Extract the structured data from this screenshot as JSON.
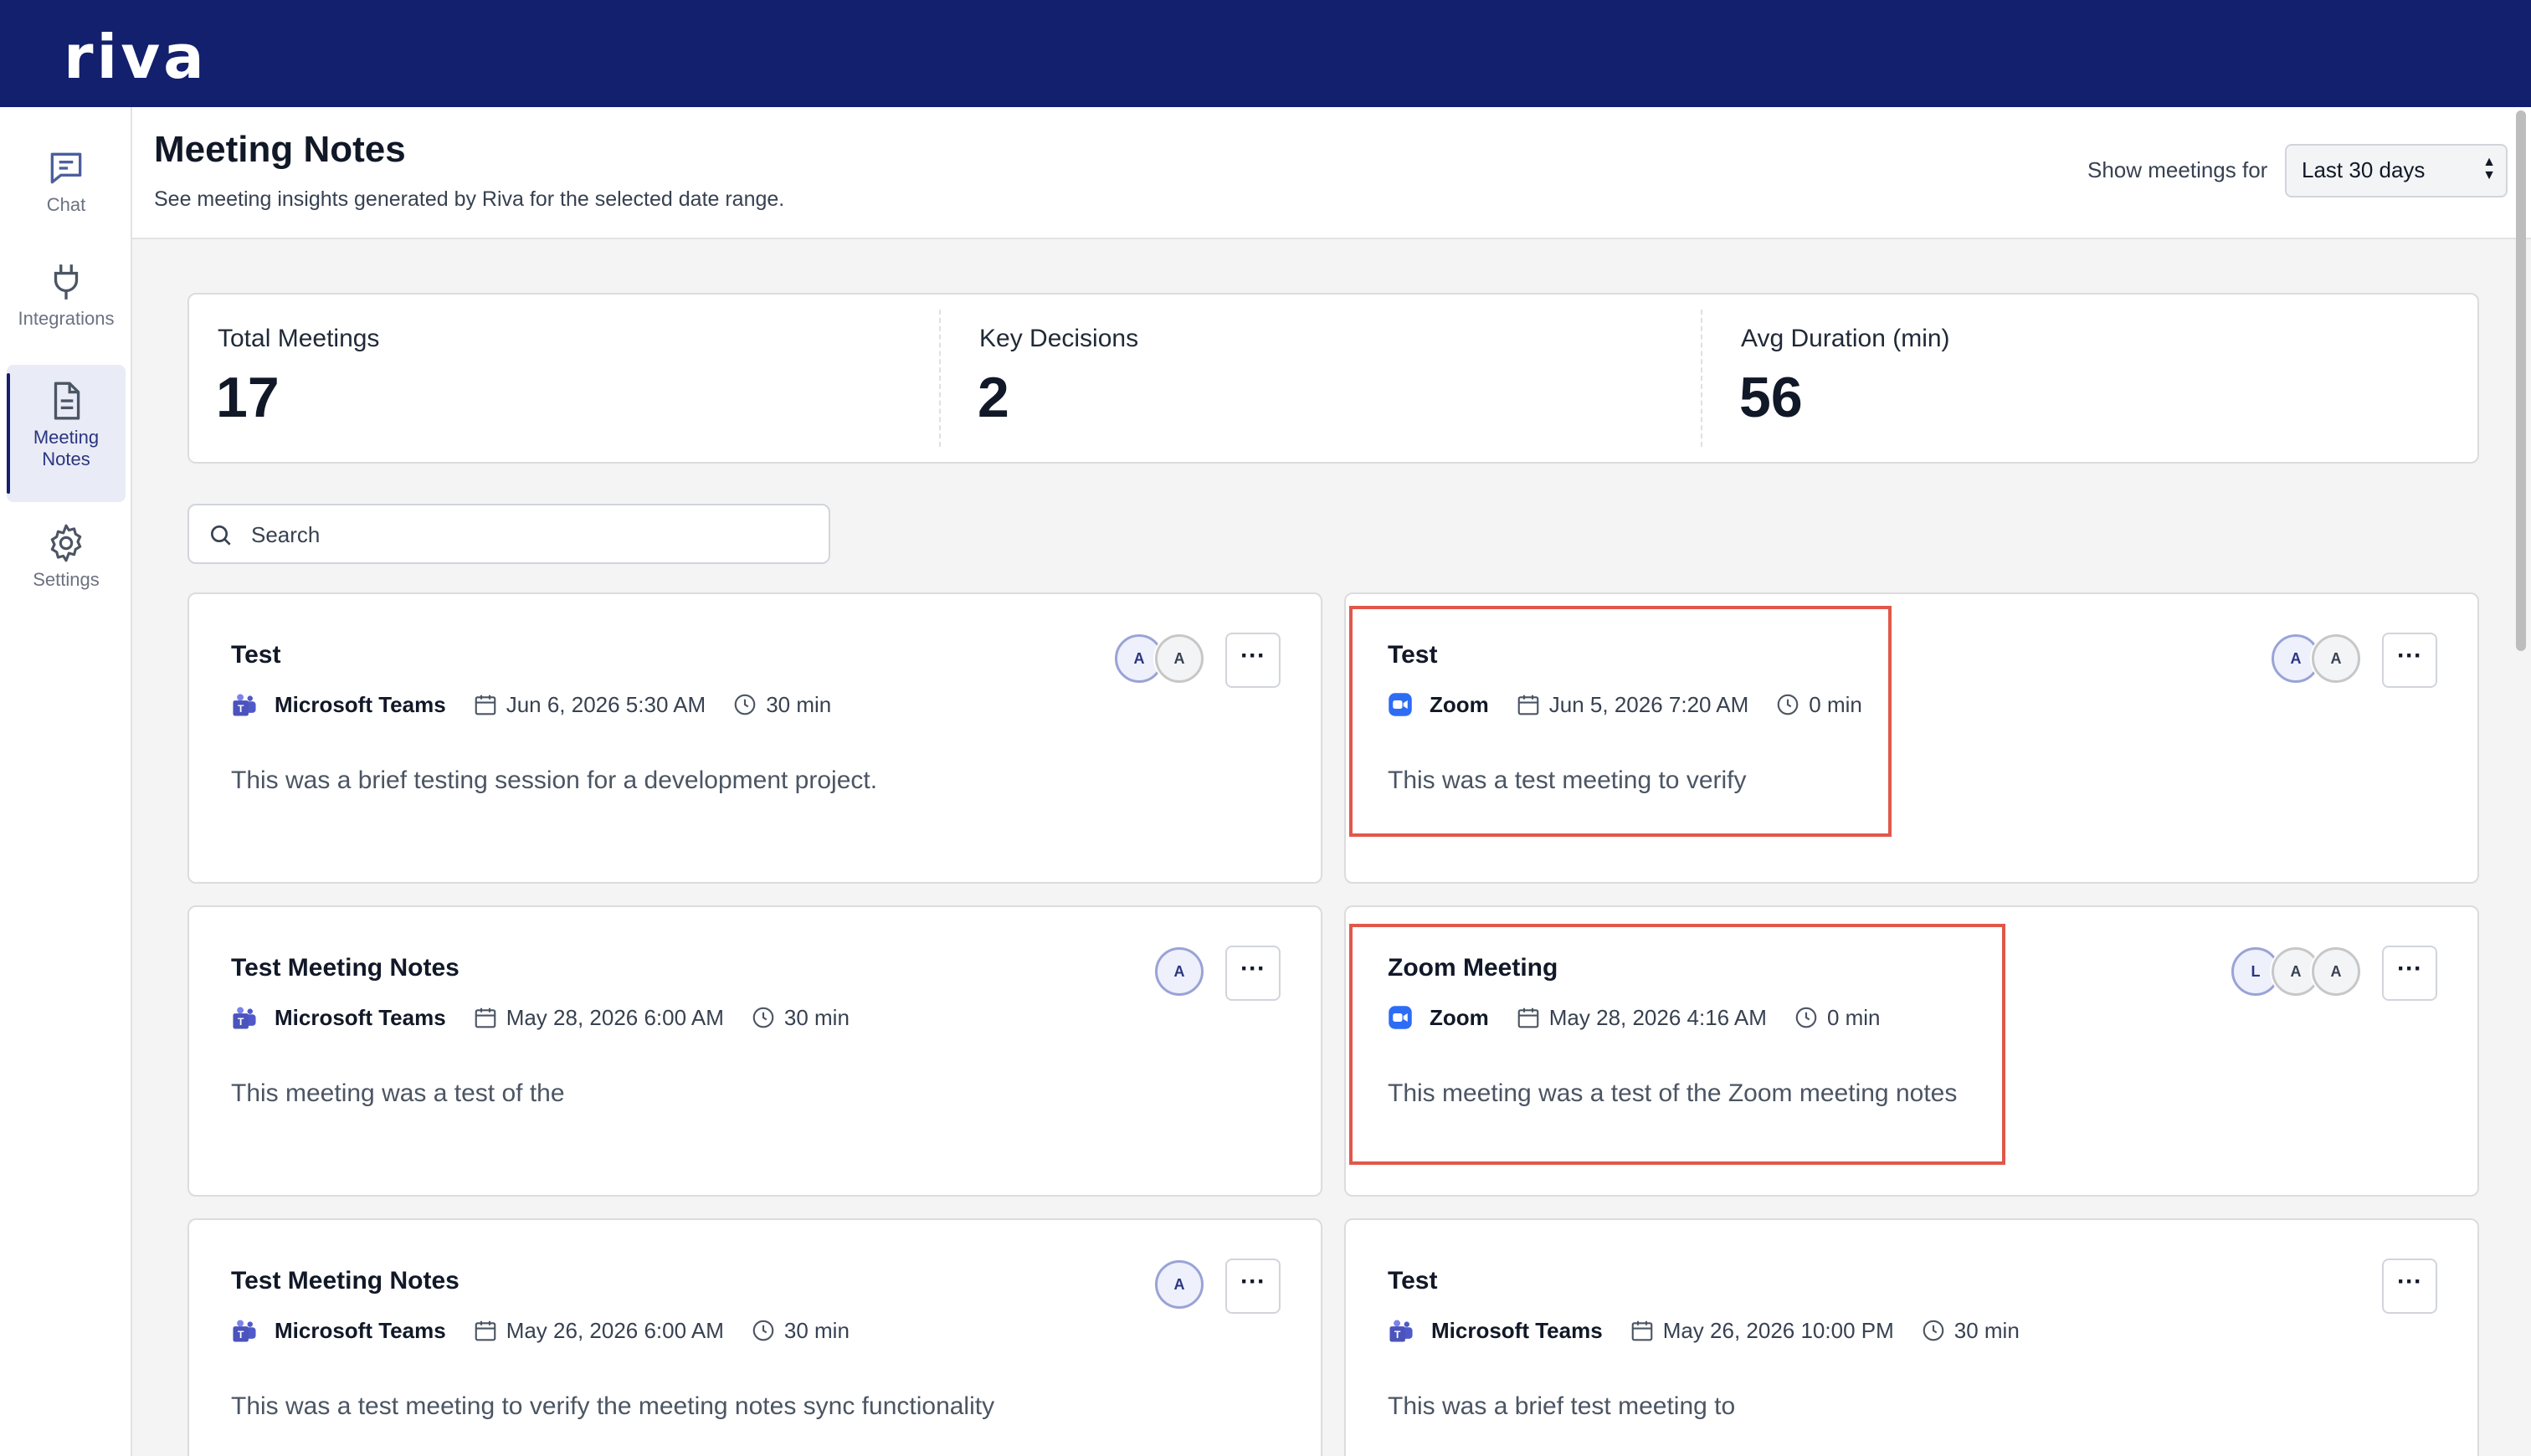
{
  "app": {
    "logo": "riva"
  },
  "sidebar": {
    "items": [
      {
        "label": "Chat",
        "icon": "chat-icon",
        "active": false
      },
      {
        "label": "Integrations",
        "icon": "plug-icon",
        "active": false
      },
      {
        "label_line1": "Meeting",
        "label_line2": "Notes",
        "icon": "document-icon",
        "active": true
      },
      {
        "label": "Settings",
        "icon": "gear-icon",
        "active": false
      }
    ]
  },
  "header": {
    "title": "Meeting Notes",
    "subtitle": "See meeting insights generated by Riva for the selected date range.",
    "range_label": "Show meetings for",
    "range_selected": "Last 30 days"
  },
  "stats": [
    {
      "label": "Total Meetings",
      "value": "17"
    },
    {
      "label": "Key Decisions",
      "value": "2"
    },
    {
      "label": "Avg Duration (min)",
      "value": "56"
    }
  ],
  "search": {
    "placeholder": "Search"
  },
  "meetings": [
    {
      "title": "Test",
      "platform": "Microsoft Teams",
      "date": "Jun 6, 2026 5:30 AM",
      "duration": "30 min",
      "summary": "This was a brief testing session for a development project.",
      "attendees": [
        "A",
        "A"
      ]
    },
    {
      "title": "Test",
      "platform": "Zoom",
      "date": "Jun 5, 2026 7:20 AM",
      "duration": "0 min",
      "summary": "This was a test meeting to verify",
      "attendees": [
        "A",
        "A"
      ]
    },
    {
      "title": "Test Meeting Notes",
      "platform": "Microsoft Teams",
      "date": "May 28, 2026 6:00 AM",
      "duration": "30 min",
      "summary": "This meeting was a test of the",
      "attendees": [
        "A"
      ]
    },
    {
      "title": "Zoom Meeting",
      "platform": "Zoom",
      "date": "May 28, 2026 4:16 AM",
      "duration": "0 min",
      "summary": "This meeting was a test of the Zoom meeting notes",
      "attendees": [
        "L",
        "A",
        "A"
      ]
    },
    {
      "title": "Test Meeting Notes",
      "platform": "Microsoft Teams",
      "date": "May 26, 2026 6:00 AM",
      "duration": "30 min",
      "summary": "This was a test meeting to verify the meeting notes sync functionality",
      "attendees": [
        "A"
      ]
    },
    {
      "title": "Test",
      "platform": "Microsoft Teams",
      "date": "May 26, 2026 10:00 PM",
      "duration": "30 min",
      "summary": "This was a brief test meeting to",
      "attendees": []
    }
  ],
  "more_button_label": "···",
  "colors": {
    "topbar": "#13206e",
    "highlight": "#e0584a",
    "zoom": "#2d6cf5",
    "teams": "#5b5fc7"
  }
}
